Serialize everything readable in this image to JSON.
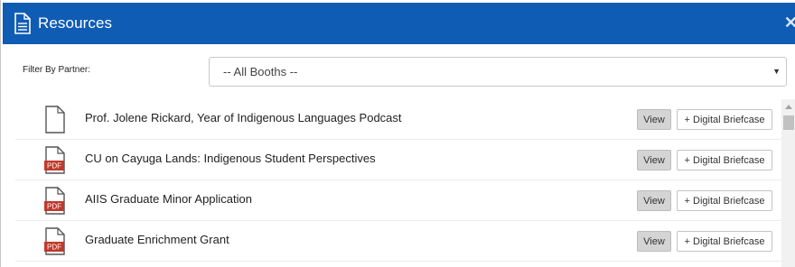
{
  "header": {
    "title": "Resources",
    "icon": "document-icon",
    "close_label": "✕",
    "background": "#0f5cb5"
  },
  "filter": {
    "label": "Filter By Partner:",
    "selected": "-- All Booths --"
  },
  "resources": [
    {
      "title": "Prof. Jolene Rickard, Year of Indigenous Languages Podcast",
      "type": "file",
      "view_label": "View",
      "briefcase_label": "+ Digital Briefcase"
    },
    {
      "title": "CU on Cayuga Lands: Indigenous Student Perspectives",
      "type": "pdf",
      "badge": "PDF",
      "view_label": "View",
      "briefcase_label": "+ Digital Briefcase"
    },
    {
      "title": "AIIS Graduate Minor Application",
      "type": "pdf",
      "badge": "PDF",
      "view_label": "View",
      "briefcase_label": "+ Digital Briefcase"
    },
    {
      "title": "Graduate Enrichment Grant",
      "type": "pdf",
      "badge": "PDF",
      "view_label": "View",
      "briefcase_label": "+ Digital Briefcase"
    }
  ],
  "colors": {
    "pdf_badge": "#c0392b"
  }
}
